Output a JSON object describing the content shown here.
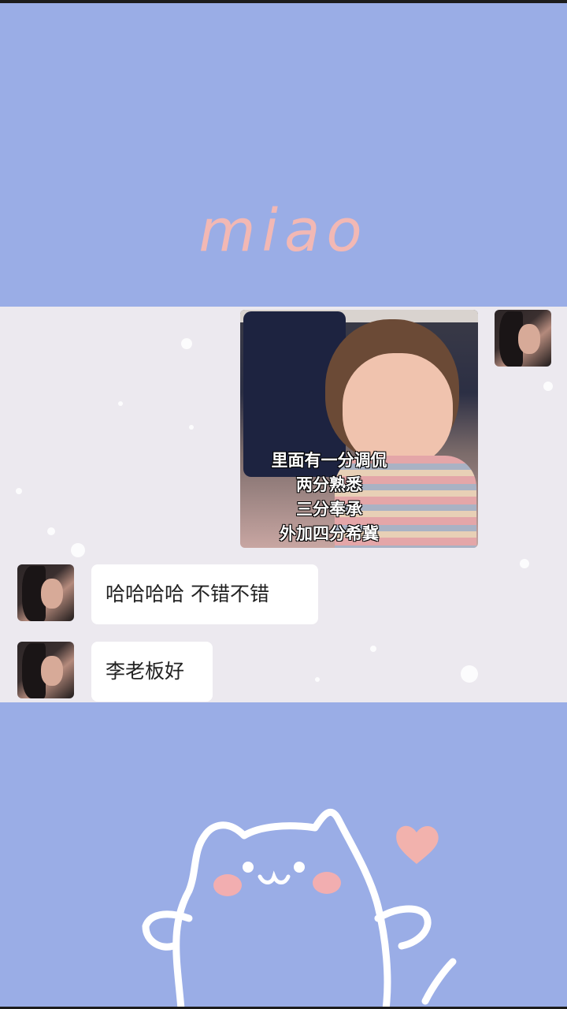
{
  "brand": {
    "title": "miao"
  },
  "chat": {
    "messages": [
      {
        "side": "right",
        "type": "image",
        "caption_lines": [
          "里面有一分调侃",
          "两分熟悉",
          "三分奉承",
          "外加四分希冀"
        ]
      },
      {
        "side": "left",
        "type": "text",
        "text": "哈哈哈哈  不错不错"
      },
      {
        "side": "left",
        "type": "text",
        "text": "李老板好"
      }
    ]
  },
  "colors": {
    "background": "#9aade6",
    "chat_background": "#ece9ef",
    "bubble": "#ffffff",
    "accent_pink": "#f2b8b4"
  },
  "icons": [
    "cat-doodle-icon",
    "heart-icon"
  ]
}
